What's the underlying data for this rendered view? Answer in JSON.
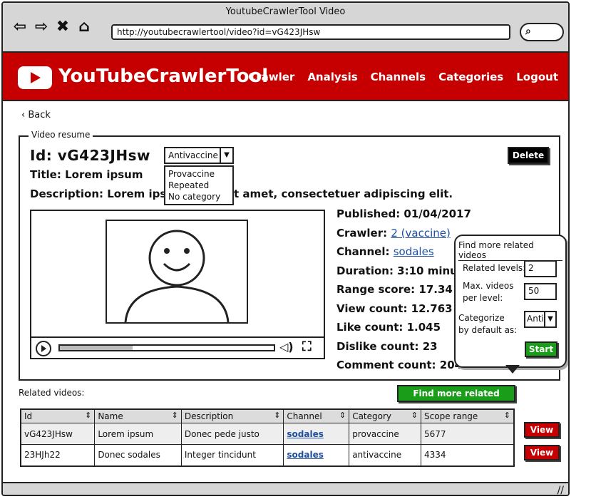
{
  "window": {
    "title": "YoutubeCrawlerTool Video"
  },
  "browser": {
    "url": "http://youtubecrawlertool/video?id=vG423JHsw",
    "back_icon": "arrow-left-icon",
    "forward_icon": "arrow-right-icon",
    "close_icon": "close-icon",
    "home_icon": "home-icon",
    "search_icon": "search-icon"
  },
  "app": {
    "brand": "YouTubeCrawlerTool",
    "accent": "#c60000",
    "menu": [
      "Crawler",
      "Analysis",
      "Channels",
      "Categories",
      "Logout"
    ]
  },
  "back": {
    "label": "Back"
  },
  "video_resume": {
    "legend": "Video resume",
    "id_line": "Id: vG423JHsw",
    "category_selected": "Antivaccine",
    "category_options": [
      "Provaccine",
      "Repeated",
      "No category"
    ],
    "delete_label": "Delete",
    "title_line": "Title: Lorem ipsum",
    "description_line": "Description: Lorem ipsum dolor sit amet, consectetuer adipiscing elit.",
    "player": {
      "progress": 0.34
    },
    "meta": {
      "published": "Published: 01/04/2017",
      "crawler_label": "Crawler:",
      "crawler_value": "2 (vaccine)",
      "channel_label": "Channel:",
      "channel_value": "sodales",
      "duration": "Duration: 3:10 minutes",
      "range_score": "Range score: 17.34",
      "view_count": "View count: 12.763",
      "like_count": "Like count: 1.045",
      "dislike_count": "Dislike count: 23",
      "comment_count": "Comment count: 204"
    }
  },
  "popover": {
    "title": "Find more related videos",
    "related_levels_label": "Related levels:",
    "related_levels_value": "2",
    "max_videos_label_1": "Max. videos",
    "max_videos_label_2": "per level:",
    "max_videos_value": "50",
    "categorize_label_1": "Categorize",
    "categorize_label_2": "by default as:",
    "categorize_value": "Anti",
    "start_label": "Start"
  },
  "related": {
    "label": "Related videos:",
    "find_more_label": "Find more related videos",
    "columns": [
      "Id",
      "Name",
      "Description",
      "Channel",
      "Category",
      "Scope range"
    ],
    "rows": [
      {
        "id": "vG423JHsw",
        "name": "Lorem ipsum",
        "description": "Donec pede justo",
        "channel": "sodales",
        "category": "provaccine",
        "scope": "5677",
        "action": "View"
      },
      {
        "id": "23HJh22",
        "name": "Donec sodales",
        "description": "Integer tincidunt",
        "channel": "sodales",
        "category": "antivaccine",
        "scope": "4334",
        "action": "View"
      }
    ]
  }
}
